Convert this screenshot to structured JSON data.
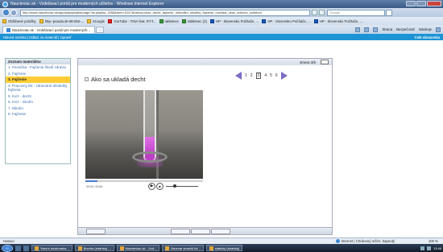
{
  "window": {
    "title": "Naucteviac.sk - Vzdelávací portál pre moderných učiteľov - Windows Internet Explorer"
  },
  "address": {
    "url": "http://www.naucteviac.sk/app/play/playlist/page?ds.playlist_3268&item=5147&history.ukaz_decht_fajcenie_mikrofilm_skrytiky_fajcenie_novinka_ukaz_ucitelov_ucitelom",
    "search_placeholder": "Google"
  },
  "favorites": {
    "items": [
      {
        "label": "Obľúbené položky",
        "icon": "star-icon"
      },
      {
        "label": "http--pravda.sk-08-052-...",
        "icon": "page-icon"
      },
      {
        "label": "iGoogle",
        "icon": "google-icon"
      },
      {
        "label": "YouTube - TINA feat. RYT...",
        "icon": "youtube-icon"
      },
      {
        "label": "tabletnec",
        "icon": "folder-icon"
      },
      {
        "label": "tabletnec (2)",
        "icon": "folder-icon"
      },
      {
        "label": "HP - Slovensko Počítače, ...",
        "icon": "hp-icon"
      },
      {
        "label": "HP - Slovensko Počítače, ...",
        "icon": "hp-icon"
      },
      {
        "label": "HP - Slovensko Počítače, ...",
        "icon": "hp-icon"
      }
    ]
  },
  "tab": {
    "label": "Naucteviac.sk - Vzdelávací portál pre moderných..."
  },
  "commands": {
    "page": "Strana",
    "safety": "Bezpečnosť",
    "tools": "Nástroje"
  },
  "site": {
    "nav": "Hlavná stránka | Odkaz na materiál | Upraviť",
    "fullscreen": "Celá obrazovka"
  },
  "menu": {
    "heading": "Zoznam materiálov",
    "items": [
      {
        "label": "1. Pesnička - Fajčenie škodí zdraviu",
        "active": false
      },
      {
        "label": "2. Fajčenie",
        "active": false
      },
      {
        "label": "3. Fajčenie",
        "active": true
      },
      {
        "label": "4. Pracovný list - zdravotné dôsledky fajčenia",
        "active": false
      },
      {
        "label": "5. Kvíz - decht",
        "active": false
      },
      {
        "label": "6. Kvíz - nikotín",
        "active": false
      },
      {
        "label": "7. Nikotín",
        "active": false
      },
      {
        "label": "8. Fajčenie",
        "active": false
      }
    ]
  },
  "lesson": {
    "page_label": "strana",
    "page_value": "3/6",
    "title": "Ako sa ukladá decht",
    "pages": [
      "1",
      "2",
      "3",
      "4",
      "5",
      "6"
    ],
    "current_page": "3",
    "video_time": "00:03 / 00:50",
    "video_progress": 0.1,
    "volume_level": 0.25
  },
  "status": {
    "text": "Hotovo",
    "zone": "Internet | Chránený režim: Zapnutý",
    "zoom": "100 %"
  },
  "taskbar": {
    "tasks": [
      "Yasu's bookmarks...",
      "Brezňa (stránka) ...",
      "Naucteviac.sk - Vzd...",
      "Nezmar zmenilí fol...",
      "statinky (stránka)"
    ],
    "clock": "13:46"
  }
}
